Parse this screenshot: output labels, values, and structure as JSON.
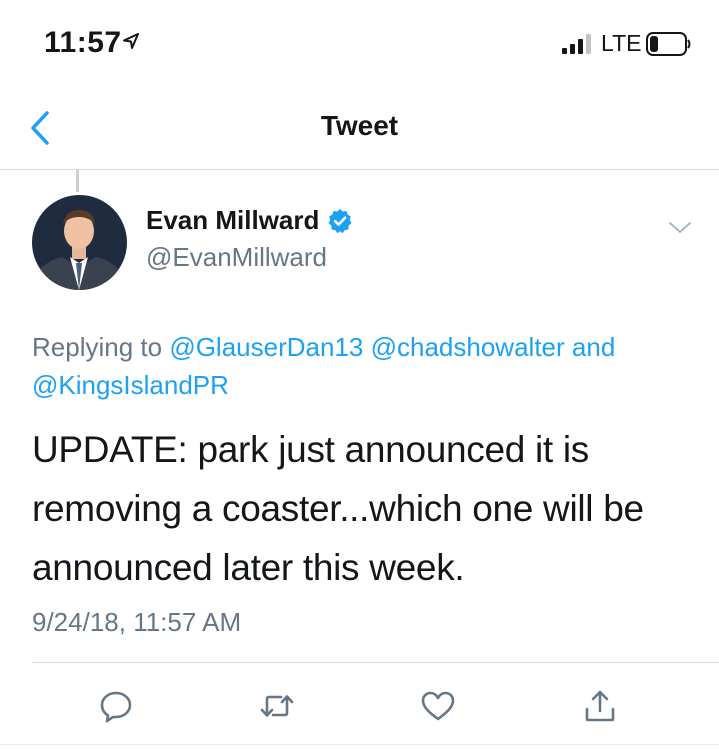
{
  "status_bar": {
    "time": "11:57",
    "network": "LTE"
  },
  "nav": {
    "title": "Tweet"
  },
  "tweet": {
    "author_name": "Evan Millward",
    "author_handle": "@EvanMillward",
    "replying_prefix": "Replying to",
    "replying_to": [
      "@GlauserDan13",
      "@chadshowalter"
    ],
    "replying_conjunction": "and",
    "replying_last": "@KingsIslandPR",
    "body_lines": [
      "UPDATE: park just announced it is",
      "removing a coaster...which one will be",
      "announced later this week."
    ],
    "timestamp": "9/24/18, 11:57 AM"
  },
  "icons": {
    "back": "chevron-left-icon",
    "verified": "verified-badge-icon",
    "caret": "chevron-down-icon",
    "reply": "reply-icon",
    "retweet": "retweet-icon",
    "like": "heart-icon",
    "share": "share-icon"
  },
  "colors": {
    "accent": "#1da1f2",
    "secondary_text": "#657786",
    "icon_gray": "#657786",
    "divider": "#d6dbdf"
  }
}
